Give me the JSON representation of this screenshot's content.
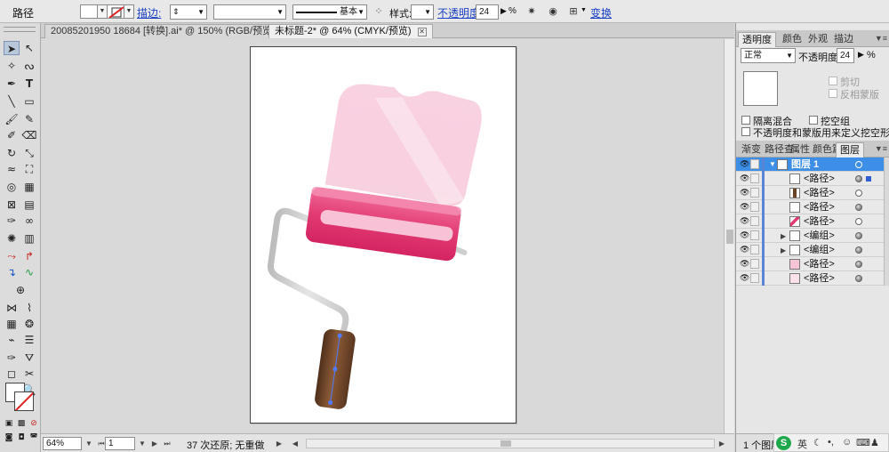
{
  "control_bar": {
    "selection_label": "路径",
    "stroke_link": "描边:",
    "stroke_profile": "基本",
    "style_label": "样式:",
    "opacity_link": "不透明度:",
    "opacity_value": "24",
    "opacity_unit": "%",
    "transform_link": "变换"
  },
  "tabs": [
    {
      "label": "20085201950 18684 [转换].ai* @ 150% (RGB/预览)"
    },
    {
      "label": "未标题-2* @ 64% (CMYK/预览)"
    }
  ],
  "status_bar": {
    "zoom": "64%",
    "page": "1",
    "history": "37 次还原; 无重做"
  },
  "transparency_panel": {
    "tabs": [
      "透明度",
      "颜色",
      "外观",
      "描边"
    ],
    "blend_mode": "正常",
    "opacity_label": "不透明度:",
    "opacity_value": "24",
    "opacity_unit": "%",
    "clip_label": "剪切",
    "invert_mask_label": "反相蒙版",
    "isolate_blend_label": "隔离混合",
    "knockout_group_label": "挖空组",
    "opacity_mask_label": "不透明度和蒙版用来定义挖空形状"
  },
  "layers_panel": {
    "tabs": [
      "渐变",
      "路径查",
      "属性",
      "颜色篇",
      "图层"
    ],
    "rows": [
      {
        "name": "图层 1"
      },
      {
        "name": "<路径>"
      },
      {
        "name": "<路径>"
      },
      {
        "name": "<路径>"
      },
      {
        "name": "<路径>"
      },
      {
        "name": "<编组>"
      },
      {
        "name": "<编组>"
      },
      {
        "name": "<路径>"
      },
      {
        "name": "<路径>"
      }
    ],
    "footer": "1 个图层"
  },
  "taskbar": {
    "ime_logo": "S",
    "ime_lang": "英"
  },
  "colors": {
    "roller_pink_dark": "#e23a72",
    "roller_pink_light": "#f7c3d6",
    "handle_brown": "#6b4428",
    "layer_selected": "#3d8ee6"
  }
}
